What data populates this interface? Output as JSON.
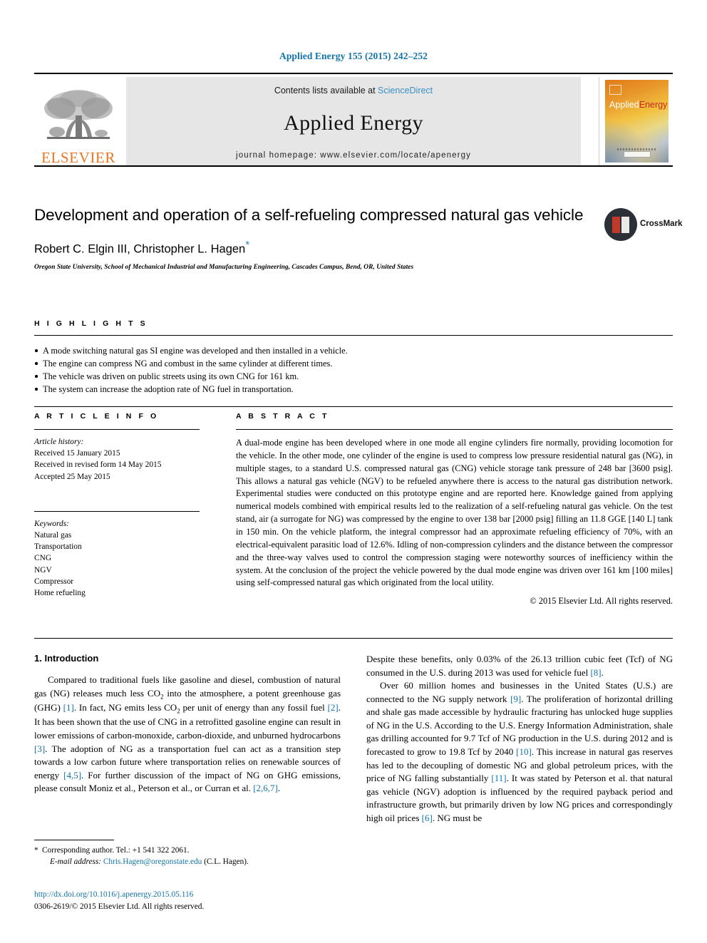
{
  "running_head": "Applied Energy 155 (2015) 242–252",
  "masthead": {
    "contents_prefix": "Contents lists available at ",
    "sciencedirect": "ScienceDirect",
    "journal_name": "Applied Energy",
    "homepage": "journal homepage: www.elsevier.com/locate/apenergy",
    "publisher_logo_text": "ELSEVIER",
    "cover": {
      "title_part1": "Applied",
      "title_part2": "Energy"
    }
  },
  "article": {
    "title": "Development and operation of a self-refueling compressed natural gas vehicle",
    "authors": "Robert C. Elgin III, Christopher L. Hagen",
    "corresponding_marker": "*",
    "affiliation": "Oregon State University, School of Mechanical Industrial and Manufacturing Engineering, Cascades Campus, Bend, OR, United States",
    "crossmark_label": "CrossMark"
  },
  "highlights": {
    "heading": "H I G H L I G H T S",
    "items": [
      "A mode switching natural gas SI engine was developed and then installed in a vehicle.",
      "The engine can compress NG and combust in the same cylinder at different times.",
      "The vehicle was driven on public streets using its own CNG for 161 km.",
      "The system can increase the adoption rate of NG fuel in transportation."
    ]
  },
  "article_info": {
    "heading": "A R T I C L E    I N F O",
    "history_label": "Article history:",
    "history": [
      "Received 15 January 2015",
      "Received in revised form 14 May 2015",
      "Accepted 25 May 2015"
    ],
    "keywords_label": "Keywords:",
    "keywords": [
      "Natural gas",
      "Transportation",
      "CNG",
      "NGV",
      "Compressor",
      "Home refueling"
    ]
  },
  "abstract": {
    "heading": "A B S T R A C T",
    "text": "A dual-mode engine has been developed where in one mode all engine cylinders fire normally, providing locomotion for the vehicle. In the other mode, one cylinder of the engine is used to compress low pressure residential natural gas (NG), in multiple stages, to a standard U.S. compressed natural gas (CNG) vehicle storage tank pressure of 248 bar [3600 psig]. This allows a natural gas vehicle (NGV) to be refueled anywhere there is access to the natural gas distribution network. Experimental studies were conducted on this prototype engine and are reported here. Knowledge gained from applying numerical models combined with empirical results led to the realization of a self-refueling natural gas vehicle. On the test stand, air (a surrogate for NG) was compressed by the engine to over 138 bar [2000 psig] filling an 11.8 GGE [140 L] tank in 150 min. On the vehicle platform, the integral compressor had an approximate refueling efficiency of 70%, with an electrical-equivalent parasitic load of 12.6%. Idling of non-compression cylinders and the distance between the compressor and the three-way valves used to control the compression staging were noteworthy sources of inefficiency within the system. At the conclusion of the project the vehicle powered by the dual mode engine was driven over 161 km [100 miles] using self-compressed natural gas which originated from the local utility.",
    "copyright": "© 2015 Elsevier Ltd. All rights reserved."
  },
  "introduction": {
    "heading": "1. Introduction",
    "left_paragraphs": [
      "Compared to traditional fuels like gasoline and diesel, combustion of natural gas (NG) releases much less CO2 into the atmosphere, a potent greenhouse gas (GHG) [1]. In fact, NG emits less CO2 per unit of energy than any fossil fuel [2]. It has been shown that the use of CNG in a retrofitted gasoline engine can result in lower emissions of carbon-monoxide, carbon-dioxide, and unburned hydrocarbons [3]. The adoption of NG as a transportation fuel can act as a transition step towards a low carbon future where transportation relies on renewable sources of energy [4,5]. For further discussion of the impact of NG on GHG emissions, please consult Moniz et al., Peterson et al., or Curran et al. [2,6,7]."
    ],
    "right_paragraphs": [
      "Despite these benefits, only 0.03% of the 26.13 trillion cubic feet (Tcf) of NG consumed in the U.S. during 2013 was used for vehicle fuel [8].",
      "Over 60 million homes and businesses in the United States (U.S.) are connected to the NG supply network [9]. The proliferation of horizontal drilling and shale gas made accessible by hydraulic fracturing has unlocked huge supplies of NG in the U.S. According to the U.S. Energy Information Administration, shale gas drilling accounted for 9.7 Tcf of NG production in the U.S. during 2012 and is forecasted to grow to 19.8 Tcf by 2040 [10]. This increase in natural gas reserves has led to the decoupling of domestic NG and global petroleum prices, with the price of NG falling substantially [11]. It was stated by Peterson et al. that natural gas vehicle (NGV) adoption is influenced by the required payback period and infrastructure growth, but primarily driven by low NG prices and correspondingly high oil prices [6]. NG must be"
    ]
  },
  "footer": {
    "corresponding_star": "*",
    "corresponding_text": "Corresponding author. Tel.: +1 541 322 2061.",
    "email_label": "E-mail address:",
    "email": "Chris.Hagen@oregonstate.edu",
    "email_suffix": "(C.L. Hagen).",
    "doi": "http://dx.doi.org/10.1016/j.apenergy.2015.05.116",
    "issn_line": "0306-2619/© 2015 Elsevier Ltd. All rights reserved."
  },
  "colors": {
    "link_blue": "#1273a8",
    "elsevier_orange": "#E87722",
    "sciencedirect_blue": "#3a8fc8"
  }
}
